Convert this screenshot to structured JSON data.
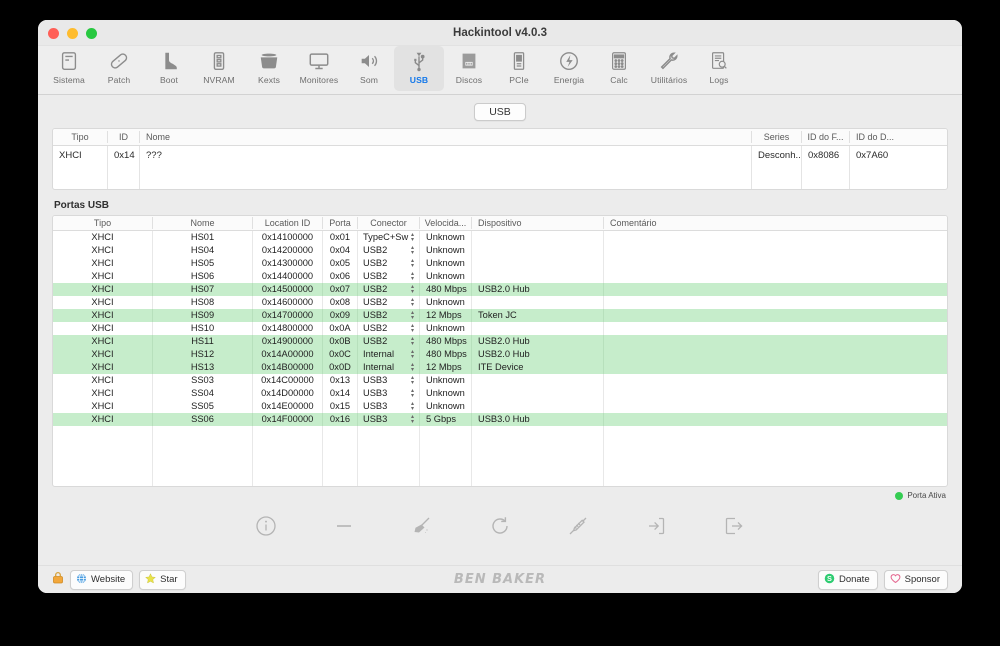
{
  "window": {
    "title": "Hackintool v4.0.3",
    "traffic_lights": [
      "close-red",
      "minimize-yellow",
      "zoom-green"
    ]
  },
  "toolbar": {
    "items": [
      {
        "label": "Sistema",
        "icon": "computer-icon",
        "active": false
      },
      {
        "label": "Patch",
        "icon": "bandage-icon",
        "active": false
      },
      {
        "label": "Boot",
        "icon": "boot-icon",
        "active": false
      },
      {
        "label": "NVRAM",
        "icon": "memory-chip-icon",
        "active": false
      },
      {
        "label": "Kexts",
        "icon": "box-icon",
        "active": false
      },
      {
        "label": "Monitores",
        "icon": "display-icon",
        "active": false
      },
      {
        "label": "Som",
        "icon": "speaker-icon",
        "active": false
      },
      {
        "label": "USB",
        "icon": "usb-icon",
        "active": true
      },
      {
        "label": "Discos",
        "icon": "disk-icon",
        "active": false
      },
      {
        "label": "PCIe",
        "icon": "pcie-card-icon",
        "active": false
      },
      {
        "label": "Energia",
        "icon": "power-bolt-icon",
        "active": false
      },
      {
        "label": "Calc",
        "icon": "calculator-icon",
        "active": false
      },
      {
        "label": "Utilitários",
        "icon": "wrench-icon",
        "active": false
      },
      {
        "label": "Logs",
        "icon": "log-search-icon",
        "active": false
      }
    ]
  },
  "segmented": {
    "usb_label": "USB"
  },
  "controller_table": {
    "columns": [
      "Tipo",
      "ID",
      "Nome",
      "Series",
      "ID do F...",
      "ID do D..."
    ],
    "rows": [
      {
        "tipo": "XHCI",
        "id": "0x14",
        "nome": "???",
        "series": "Desconh...",
        "id_fabricante": "0x8086",
        "id_dispositivo": "0x7A60"
      }
    ]
  },
  "ports_section": {
    "title": "Portas USB",
    "columns": [
      "Tipo",
      "Nome",
      "Location ID",
      "Porta",
      "Conector",
      "Velocida...",
      "Dispositivo",
      "Comentário"
    ],
    "rows": [
      {
        "tipo": "XHCI",
        "nome": "HS01",
        "location_id": "0x14100000",
        "porta": "0x01",
        "conector": "TypeC+Sw",
        "velocidade": "Unknown",
        "dispositivo": "",
        "comentario": "",
        "active": false
      },
      {
        "tipo": "XHCI",
        "nome": "HS04",
        "location_id": "0x14200000",
        "porta": "0x04",
        "conector": "USB2",
        "velocidade": "Unknown",
        "dispositivo": "",
        "comentario": "",
        "active": false
      },
      {
        "tipo": "XHCI",
        "nome": "HS05",
        "location_id": "0x14300000",
        "porta": "0x05",
        "conector": "USB2",
        "velocidade": "Unknown",
        "dispositivo": "",
        "comentario": "",
        "active": false
      },
      {
        "tipo": "XHCI",
        "nome": "HS06",
        "location_id": "0x14400000",
        "porta": "0x06",
        "conector": "USB2",
        "velocidade": "Unknown",
        "dispositivo": "",
        "comentario": "",
        "active": false
      },
      {
        "tipo": "XHCI",
        "nome": "HS07",
        "location_id": "0x14500000",
        "porta": "0x07",
        "conector": "USB2",
        "velocidade": "480 Mbps",
        "dispositivo": "USB2.0 Hub",
        "comentario": "",
        "active": true
      },
      {
        "tipo": "XHCI",
        "nome": "HS08",
        "location_id": "0x14600000",
        "porta": "0x08",
        "conector": "USB2",
        "velocidade": "Unknown",
        "dispositivo": "",
        "comentario": "",
        "active": false
      },
      {
        "tipo": "XHCI",
        "nome": "HS09",
        "location_id": "0x14700000",
        "porta": "0x09",
        "conector": "USB2",
        "velocidade": "12 Mbps",
        "dispositivo": "Token JC",
        "comentario": "",
        "active": true
      },
      {
        "tipo": "XHCI",
        "nome": "HS10",
        "location_id": "0x14800000",
        "porta": "0x0A",
        "conector": "USB2",
        "velocidade": "Unknown",
        "dispositivo": "",
        "comentario": "",
        "active": false
      },
      {
        "tipo": "XHCI",
        "nome": "HS11",
        "location_id": "0x14900000",
        "porta": "0x0B",
        "conector": "USB2",
        "velocidade": "480 Mbps",
        "dispositivo": "USB2.0 Hub",
        "comentario": "",
        "active": true
      },
      {
        "tipo": "XHCI",
        "nome": "HS12",
        "location_id": "0x14A00000",
        "porta": "0x0C",
        "conector": "Internal",
        "velocidade": "480 Mbps",
        "dispositivo": "USB2.0 Hub",
        "comentario": "",
        "active": true
      },
      {
        "tipo": "XHCI",
        "nome": "HS13",
        "location_id": "0x14B00000",
        "porta": "0x0D",
        "conector": "Internal",
        "velocidade": "12 Mbps",
        "dispositivo": "ITE Device",
        "comentario": "",
        "active": true
      },
      {
        "tipo": "XHCI",
        "nome": "SS03",
        "location_id": "0x14C00000",
        "porta": "0x13",
        "conector": "USB3",
        "velocidade": "Unknown",
        "dispositivo": "",
        "comentario": "",
        "active": false
      },
      {
        "tipo": "XHCI",
        "nome": "SS04",
        "location_id": "0x14D00000",
        "porta": "0x14",
        "conector": "USB3",
        "velocidade": "Unknown",
        "dispositivo": "",
        "comentario": "",
        "active": false
      },
      {
        "tipo": "XHCI",
        "nome": "SS05",
        "location_id": "0x14E00000",
        "porta": "0x15",
        "conector": "USB3",
        "velocidade": "Unknown",
        "dispositivo": "",
        "comentario": "",
        "active": false
      },
      {
        "tipo": "XHCI",
        "nome": "SS06",
        "location_id": "0x14F00000",
        "porta": "0x16",
        "conector": "USB3",
        "velocidade": "5 Gbps",
        "dispositivo": "USB3.0 Hub",
        "comentario": "",
        "active": true
      }
    ],
    "legend": {
      "label": "Porta Ativa",
      "color": "#35cc52"
    }
  },
  "actions": [
    {
      "name": "info-icon",
      "tooltip": "Info"
    },
    {
      "name": "minus-icon",
      "tooltip": "Remover"
    },
    {
      "name": "broom-icon",
      "tooltip": "Limpar"
    },
    {
      "name": "refresh-icon",
      "tooltip": "Atualizar"
    },
    {
      "name": "syringe-icon",
      "tooltip": "Injetar"
    },
    {
      "name": "import-icon",
      "tooltip": "Importar"
    },
    {
      "name": "export-icon",
      "tooltip": "Exportar"
    }
  ],
  "bottom_bar": {
    "lock_icon": "lock-icon",
    "website_label": "Website",
    "star_label": "Star",
    "donate_label": "Donate",
    "sponsor_label": "Sponsor",
    "watermark": "BEN BAKER"
  },
  "colors": {
    "active_row": "#c6edcb",
    "accent_blue": "#1478ea",
    "legend_green": "#35cc52",
    "donate_green": "#2ecc71",
    "sponsor_pink": "#e4668f"
  }
}
